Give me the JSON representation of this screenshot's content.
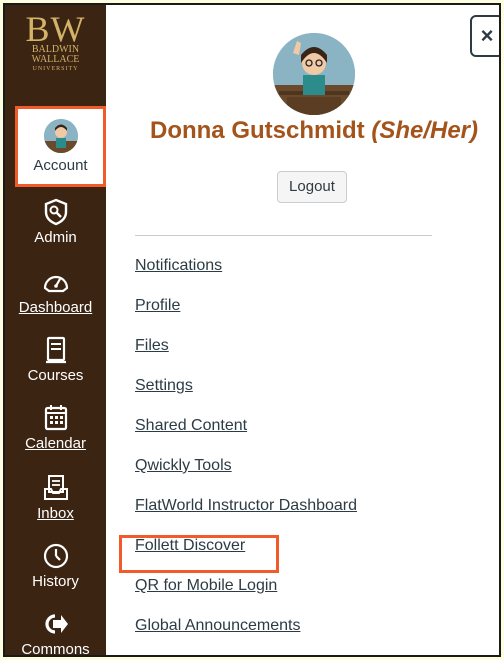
{
  "logo": {
    "initials": "BW",
    "line1": "BALDWIN",
    "line2": "WALLACE",
    "line3": "UNIVERSITY"
  },
  "nav": {
    "items": [
      {
        "label": "Account",
        "icon": "account-avatar-icon"
      },
      {
        "label": "Admin",
        "icon": "shield-icon"
      },
      {
        "label": "Dashboard",
        "icon": "speedometer-icon"
      },
      {
        "label": "Courses",
        "icon": "book-icon"
      },
      {
        "label": "Calendar",
        "icon": "calendar-icon"
      },
      {
        "label": "Inbox",
        "icon": "inbox-icon"
      },
      {
        "label": "History",
        "icon": "clock-icon"
      },
      {
        "label": "Commons",
        "icon": "commons-arrow-icon"
      }
    ]
  },
  "tray": {
    "close_label": "×",
    "user_name": "Donna Gutschmidt",
    "pronouns": "(She/Her)",
    "logout_label": "Logout",
    "links": [
      "Notifications",
      "Profile",
      "Files",
      "Settings",
      "Shared Content",
      "Qwickly Tools",
      "FlatWorld Instructor Dashboard",
      "Follett Discover",
      "QR for Mobile Login",
      "Global Announcements"
    ]
  },
  "colors": {
    "nav_bg": "#3b2412",
    "brand_gold": "#d3b26a",
    "name_color": "#a4541b",
    "highlight": "#f15a29"
  }
}
